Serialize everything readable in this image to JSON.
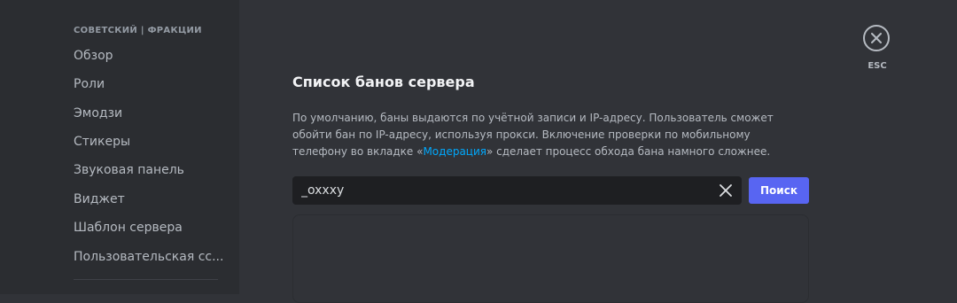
{
  "sidebar": {
    "header": "СОВЕТСКИЙ | ФРАКЦИИ",
    "items": [
      {
        "label": "Обзор"
      },
      {
        "label": "Роли"
      },
      {
        "label": "Эмодзи"
      },
      {
        "label": "Стикеры"
      },
      {
        "label": "Звуковая панель"
      },
      {
        "label": "Виджет"
      },
      {
        "label": "Шаблон сервера"
      },
      {
        "label": "Пользовательская сс..."
      }
    ]
  },
  "close": {
    "icon": "close-icon",
    "label": "ESC"
  },
  "main": {
    "title": "Список банов сервера",
    "description_before": "По умолчанию, баны выдаются по учётной записи и IP-адресу. Пользователь сможет обойти бан по IP-адресу, используя прокси. Включение проверки по мобильному телефону во вкладке «",
    "description_link": "Модерация",
    "description_after": "» сделает процесс обхода бана намного сложнее."
  },
  "search": {
    "value": "_oxxxy",
    "clear_icon": "clear-x-icon",
    "button_label": "Поиск"
  },
  "colors": {
    "accent": "#5865f2",
    "link": "#00a8fc",
    "background": "#313338",
    "sidebar": "#2b2d31"
  }
}
